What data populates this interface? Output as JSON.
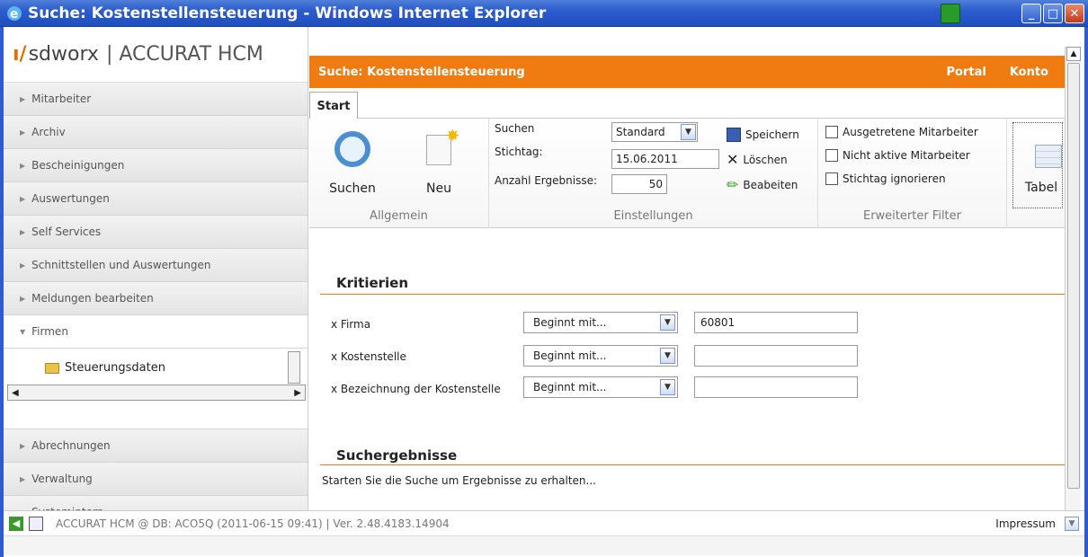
{
  "window": {
    "title": "Suche: Kostenstellensteuerung - Windows Internet Explorer"
  },
  "logo": {
    "brand": "sdworx",
    "product": "| ACCURAT HCM"
  },
  "sidebar": {
    "items": [
      {
        "label": "Mitarbeiter"
      },
      {
        "label": "Archiv"
      },
      {
        "label": "Bescheinigungen"
      },
      {
        "label": "Auswertungen"
      },
      {
        "label": "Self Services"
      },
      {
        "label": "Schnittstellen und Auswertungen"
      },
      {
        "label": "Meldungen bearbeiten"
      },
      {
        "label": "Firmen"
      }
    ],
    "tree_node": "Steuerungsdaten",
    "items_after": [
      {
        "label": "Abrechnungen"
      },
      {
        "label": "Verwaltung"
      },
      {
        "label": "Systemintern"
      }
    ]
  },
  "header": {
    "title": "Suche: Kostenstellensteuerung",
    "portal": "Portal",
    "konto": "Konto"
  },
  "tabs": [
    {
      "label": "Start"
    }
  ],
  "ribbon": {
    "allgemein": {
      "label": "Allgemein",
      "search": "Suchen",
      "new": "Neu"
    },
    "einstellungen": {
      "label": "Einstellungen",
      "suchen_label": "Suchen",
      "suchen_value": "Standard",
      "stichtag_label": "Stichtag:",
      "stichtag_value": "15.06.2011",
      "anzahl_label": "Anzahl Ergebnisse:",
      "anzahl_value": "50",
      "save": "Speichern",
      "delete": "Löschen",
      "edit": "Beabeiten"
    },
    "filter": {
      "label": "Erweiterter Filter",
      "opt1": "Ausgetretene Mitarbeiter",
      "opt2": "Nicht aktive Mitarbeiter",
      "opt3": "Stichtag ignorieren"
    },
    "table": {
      "label": "Tabel"
    }
  },
  "criteria": {
    "title": "Kritierien",
    "rows": [
      {
        "label": "x Firma",
        "op": "Beginnt mit...",
        "value": "60801"
      },
      {
        "label": "x Kostenstelle",
        "op": "Beginnt mit...",
        "value": ""
      },
      {
        "label": "x Bezeichnung der Kostenstelle",
        "op": "Beginnt mit...",
        "value": ""
      }
    ]
  },
  "results": {
    "title": "Suchergebnisse",
    "hint": "Starten Sie die Suche um Ergebnisse zu erhalten..."
  },
  "status": {
    "text": "ACCURAT HCM @ DB: ACO5Q (2011-06-15 09:41) | Ver. 2.48.4183.14904",
    "impressum": "Impressum"
  }
}
